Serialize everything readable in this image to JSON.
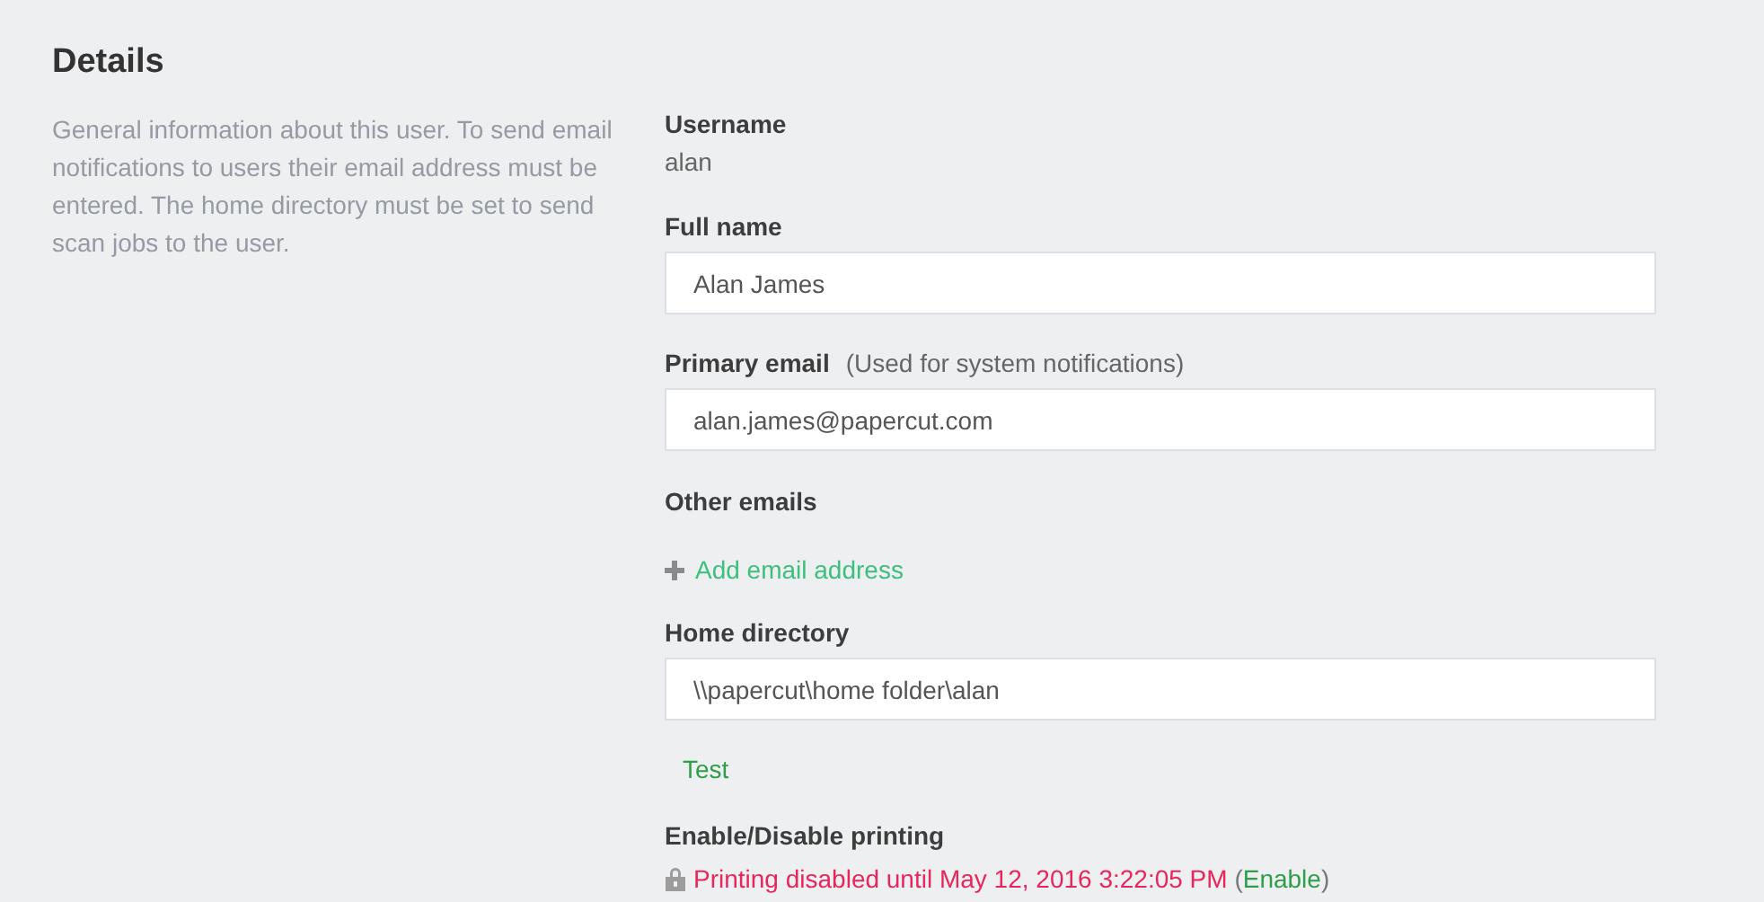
{
  "section": {
    "title": "Details",
    "description": "General information about this user. To send email notifications to users their email address must be entered. The home directory must be set to send scan jobs to the user."
  },
  "username": {
    "label": "Username",
    "value": "alan"
  },
  "full_name": {
    "label": "Full name",
    "value": "Alan James"
  },
  "primary_email": {
    "label": "Primary email",
    "note": "(Used for system notifications)",
    "value": "alan.james@papercut.com"
  },
  "other_emails": {
    "label": "Other emails",
    "add_link": "Add email address"
  },
  "home_directory": {
    "label": "Home directory",
    "value": "\\\\papercut\\home folder\\alan",
    "test_link": "Test"
  },
  "printing": {
    "label": "Enable/Disable printing",
    "disabled": true,
    "status": "Printing disabled until May 12, 2016 3:22:05 PM",
    "open_paren": "(",
    "enable_link": "Enable",
    "close_paren": ")"
  }
}
